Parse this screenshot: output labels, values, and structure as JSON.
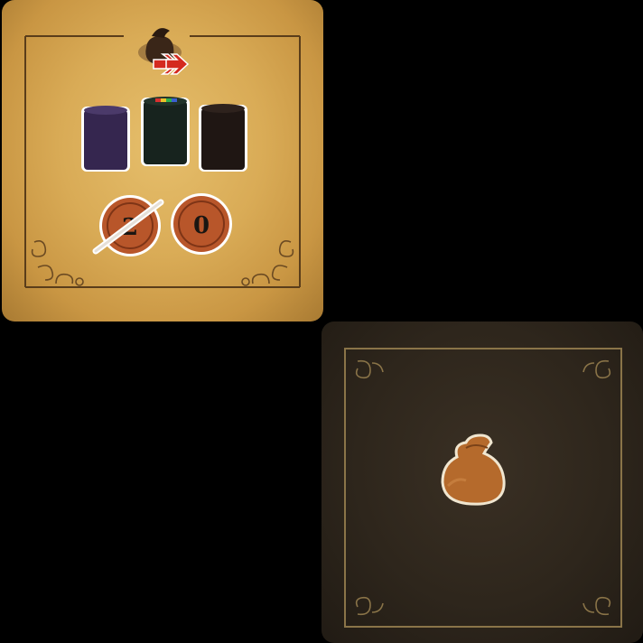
{
  "cards": [
    {
      "name": "resource-card-front",
      "top_icon": "money-bag-icon",
      "arrow_icon": "double-right-arrow-icon",
      "arrow_color": "#d42a1f",
      "cylinders": [
        {
          "color": "purple",
          "hex": "#35264f"
        },
        {
          "color": "dark-green",
          "hex": "#17231e",
          "top_stripe_colors": [
            "#d93030",
            "#e8c12a",
            "#2fae4a",
            "#3a5fd0"
          ]
        },
        {
          "color": "black-brown",
          "hex": "#1f1613"
        }
      ],
      "coins": [
        {
          "value": "2",
          "struck_out": true
        },
        {
          "value": "0",
          "struck_out": false
        }
      ],
      "background_color": "#d9ab56"
    },
    {
      "name": "resource-card-back",
      "center_icon": "money-bag-icon",
      "background_color": "#2e261c"
    }
  ]
}
